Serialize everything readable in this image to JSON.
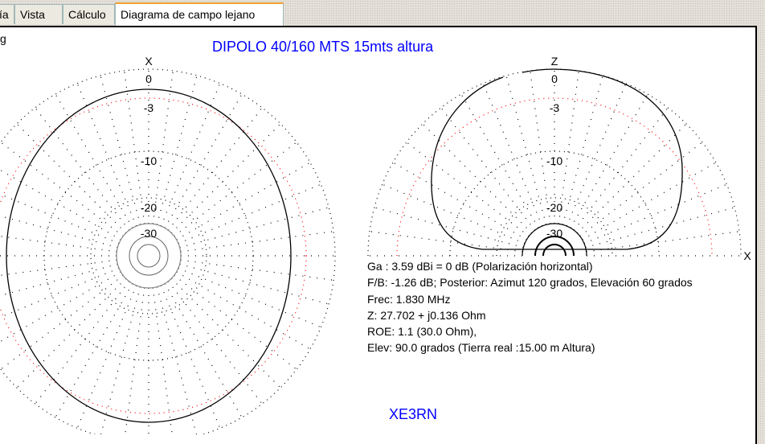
{
  "tabs": [
    {
      "label": "ía",
      "active": false
    },
    {
      "label": "Vista",
      "active": false
    },
    {
      "label": "Cálculo",
      "active": false
    },
    {
      "label": "Diagrama de campo lejano",
      "active": true
    }
  ],
  "corner_text": "g",
  "title": "DIPOLO 40/160 MTS 15mts altura",
  "footer": "XE3RN",
  "info": [
    "Ga : 3.59 dBi = 0 dB  (Polarización horizontal)",
    "F/B: -1.26 dB; Posterior: Azimut 120 grados,  Elevación 60 grados",
    "Frec: 1.830 MHz",
    "Z: 27.702 + j0.136 Ohm",
    "ROE: 1.1 (30.0 Ohm),",
    "Elev: 90.0 grados (Tierra real  :15.00 m Altura)"
  ],
  "colors": {
    "title": "#0000ff",
    "ring_red": "#ff0000",
    "pattern": "#000000"
  },
  "chart_data": {
    "type": "polar",
    "ring_labels": [
      "0",
      "-3",
      "-10",
      "-20",
      "-30"
    ],
    "ring_db": [
      0,
      -3,
      -10,
      -20,
      -30
    ],
    "plots": [
      {
        "name": "azimuth",
        "axis_label": "X",
        "half": false,
        "pattern": "elliptical, max 0 dB at 0°/180°, approx -4 dB at 90°/270°"
      },
      {
        "name": "elevation",
        "axis_label": "Z",
        "side_label": "X",
        "half": true,
        "pattern": "high-angle lobe, max 0 dB at zenith"
      }
    ]
  }
}
